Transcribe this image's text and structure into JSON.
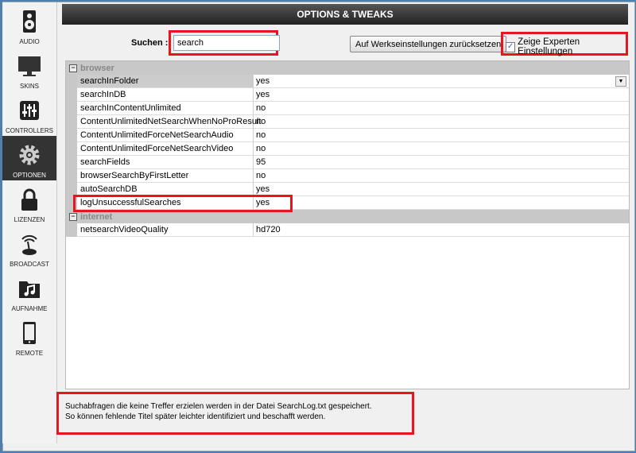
{
  "sidebar": {
    "items": [
      {
        "label": "AUDIO",
        "icon": "speaker-icon"
      },
      {
        "label": "SKINS",
        "icon": "monitor-icon"
      },
      {
        "label": "CONTROLLERS",
        "icon": "mixer-icon"
      },
      {
        "label": "OPTIONEN",
        "icon": "gear-icon",
        "active": true
      },
      {
        "label": "LIZENZEN",
        "icon": "lock-icon"
      },
      {
        "label": "BROADCAST",
        "icon": "broadcast-icon"
      },
      {
        "label": "AUFNAHME",
        "icon": "music-folder-icon"
      },
      {
        "label": "REMOTE",
        "icon": "tablet-icon"
      }
    ]
  },
  "header": {
    "title": "OPTIONS & TWEAKS"
  },
  "search": {
    "label": "Suchen :",
    "value": "search"
  },
  "reset_label": "Auf Werkseinstellungen zurücksetzen",
  "expert": {
    "label": "Zeige Experten Einstellungen",
    "checked": true,
    "check": "✓"
  },
  "groups": [
    {
      "name": "browser",
      "rows": [
        {
          "key": "searchInFolder",
          "value": "yes"
        },
        {
          "key": "searchInDB",
          "value": "yes"
        },
        {
          "key": "searchInContentUnlimited",
          "value": "no"
        },
        {
          "key": "ContentUnlimitedNetSearchWhenNoProResult",
          "value": "no"
        },
        {
          "key": "ContentUnlimitedForceNetSearchAudio",
          "value": "no"
        },
        {
          "key": "ContentUnlimitedForceNetSearchVideo",
          "value": "no"
        },
        {
          "key": "searchFields",
          "value": "95"
        },
        {
          "key": "browserSearchByFirstLetter",
          "value": "no"
        },
        {
          "key": "autoSearchDB",
          "value": "yes"
        },
        {
          "key": "logUnsuccessfulSearches",
          "value": "yes"
        }
      ]
    },
    {
      "name": "internet",
      "rows": [
        {
          "key": "netsearchVideoQuality",
          "value": "hd720"
        }
      ]
    }
  ],
  "collapse_glyph": "−",
  "dropdown_glyph": "▼",
  "info": {
    "line1": "Suchabfragen die keine Treffer erzielen werden in der Datei SearchLog.txt gespeichert.",
    "line2": "So können fehlende Titel später leichter identifiziert und beschafft werden."
  }
}
